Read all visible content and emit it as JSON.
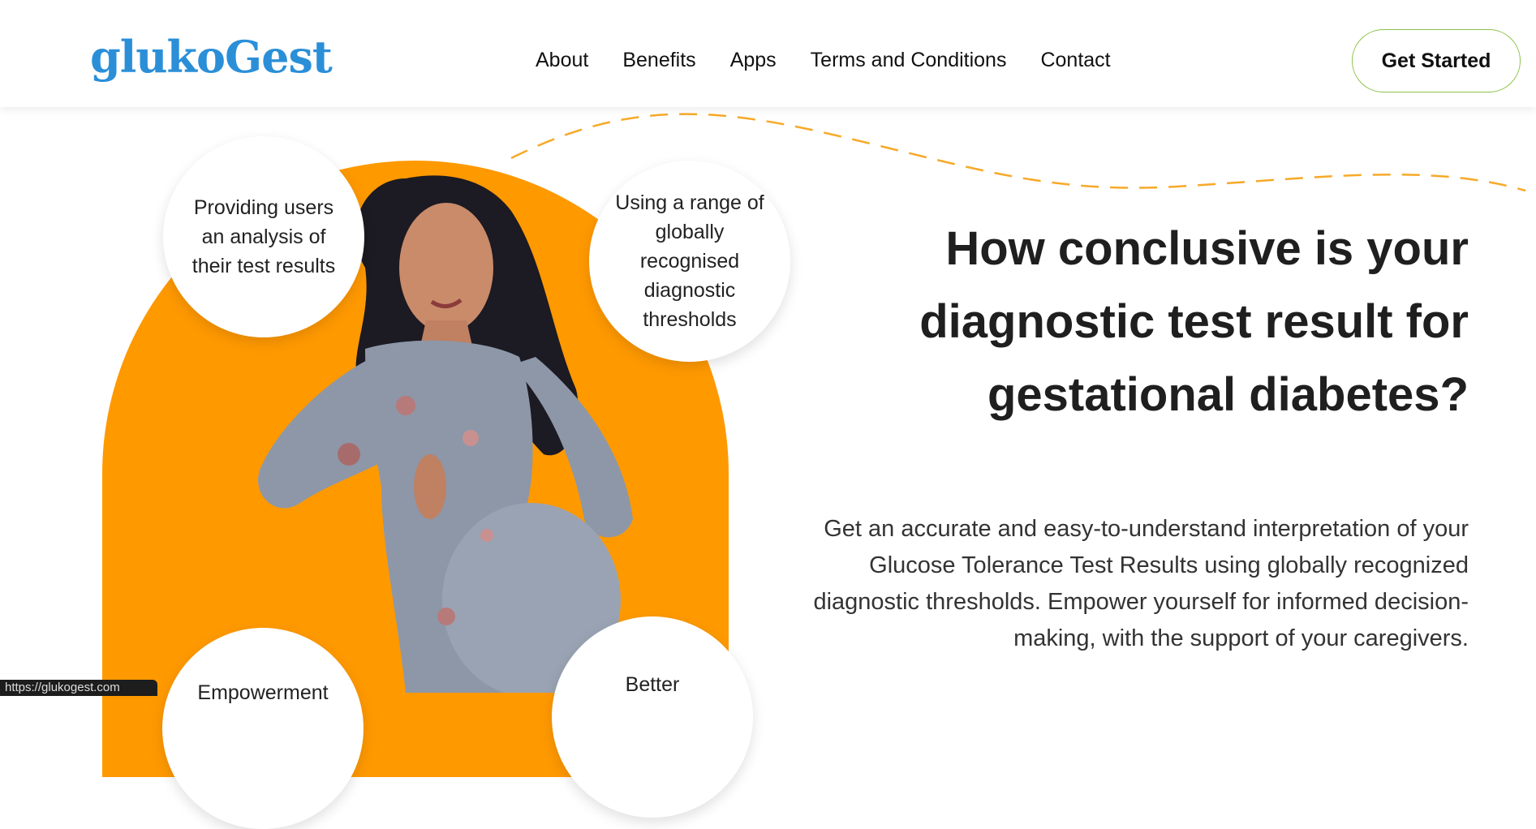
{
  "header": {
    "logo": "glukoGest",
    "nav": [
      "About",
      "Benefits",
      "Apps",
      "Terms and Conditions",
      "Contact"
    ],
    "cta_label": "Get Started"
  },
  "hero": {
    "bubbles": [
      "Providing users an analysis of their test results",
      "Using a range of globally recognised diagnostic thresholds",
      "Empowerment",
      "Better"
    ],
    "headline": "How conclusive is your diagnostic test result for gestational diabetes?",
    "description": "Get an accurate and easy-to-understand interpretation of your Glucose Tolerance Test Results using globally recognized diagnostic thresholds. Empower yourself for informed decision-making, with the support of your caregivers."
  },
  "status_bar": "https://glukogest.com",
  "colors": {
    "brand_blue": "#2b8fd8",
    "accent_orange": "#ff9900",
    "cta_border": "#8bc34a"
  }
}
